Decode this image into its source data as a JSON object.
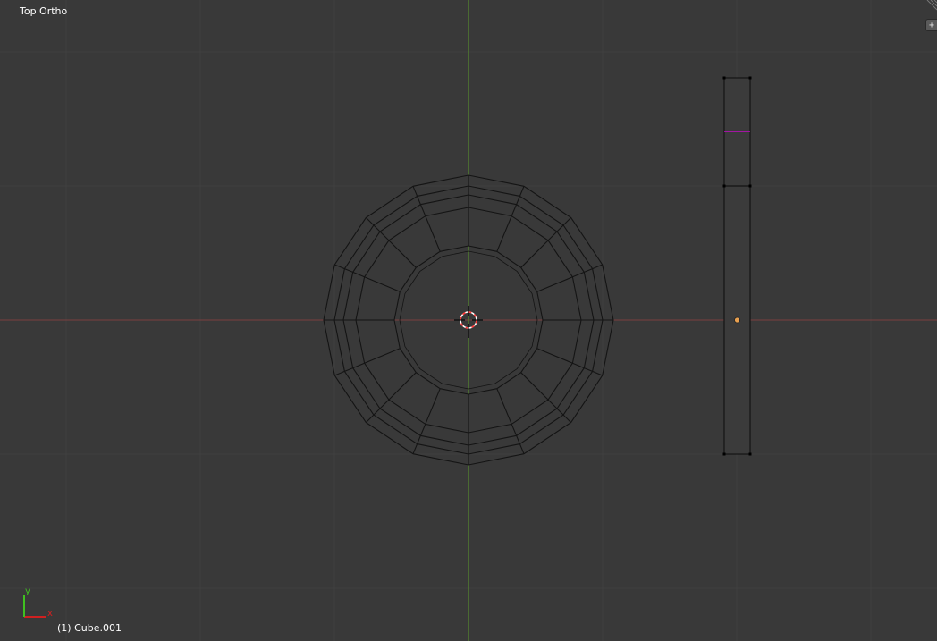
{
  "viewport": {
    "view_name": "Top Ortho",
    "object_info": "(1) Cube.001",
    "toolshelf_toggle_glyph": "+",
    "colors": {
      "background": "#393939",
      "grid_line": "#404040",
      "x_axis": "#7a4040",
      "y_axis": "#5a9a2a",
      "wire": "#141414",
      "selected_edge": "#e000e0",
      "origin_dot": "#e8a050",
      "cursor_red": "#ff3333"
    }
  },
  "axis_gizmo": {
    "x_label": "x",
    "y_label": "y",
    "x_color": "#d02020",
    "y_color": "#40c020"
  },
  "objects": [
    {
      "name": "Cube.001",
      "type": "ring-mesh",
      "rings": 5,
      "segments": 16,
      "selected": false
    },
    {
      "name": "vertical-bar",
      "type": "mesh",
      "selected_edge_color": "#e000e0",
      "has_origin": true
    }
  ]
}
